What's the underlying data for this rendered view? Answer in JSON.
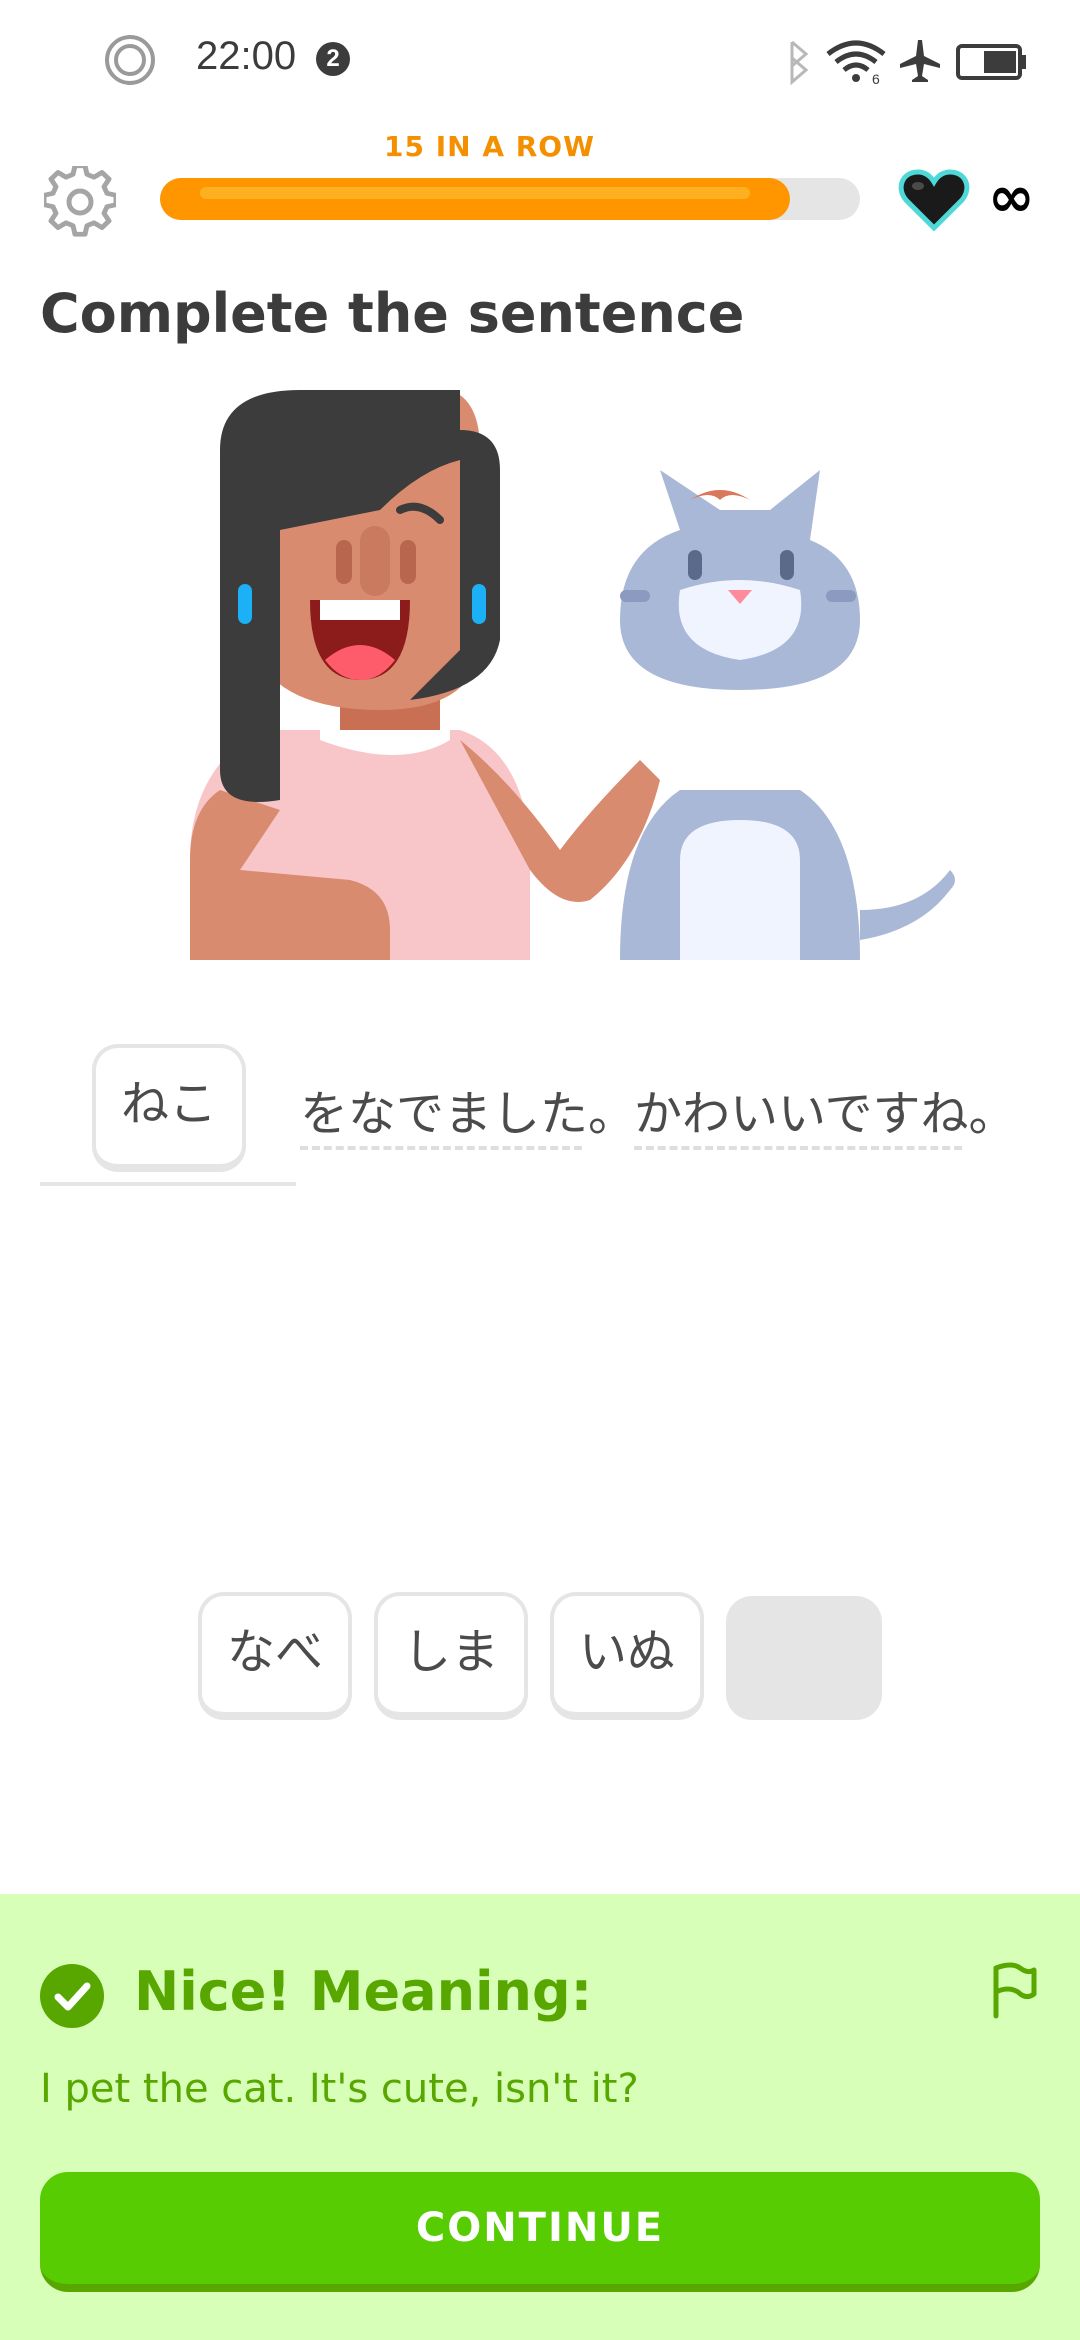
{
  "status_bar": {
    "time": "22:00",
    "notification_count": "2",
    "icons": [
      "focus-ring-icon",
      "bluetooth-icon",
      "wifi-icon",
      "airplane-mode-icon",
      "battery-icon"
    ]
  },
  "header": {
    "streak_label": "15 IN A ROW",
    "progress_fraction": 0.9,
    "lives_symbol": "∞",
    "colors": {
      "progress": "#ff9600",
      "streak": "#f49000",
      "heart_outline": "#1cb0f6"
    }
  },
  "exercise": {
    "title": "Complete the sentence",
    "answer": "ねこ",
    "sentence_parts": [
      "をなでました。",
      "かわいいですね。"
    ]
  },
  "word_bank": {
    "options": [
      "なべ",
      "しま",
      "いぬ"
    ],
    "used_slot_count": 1
  },
  "feedback": {
    "title": "Nice! Meaning:",
    "translation": "I pet the cat. It's cute, isn't it?",
    "continue_label": "CONTINUE",
    "colors": {
      "background": "#d7ffb8",
      "text": "#58a700",
      "button": "#58cc02"
    }
  }
}
